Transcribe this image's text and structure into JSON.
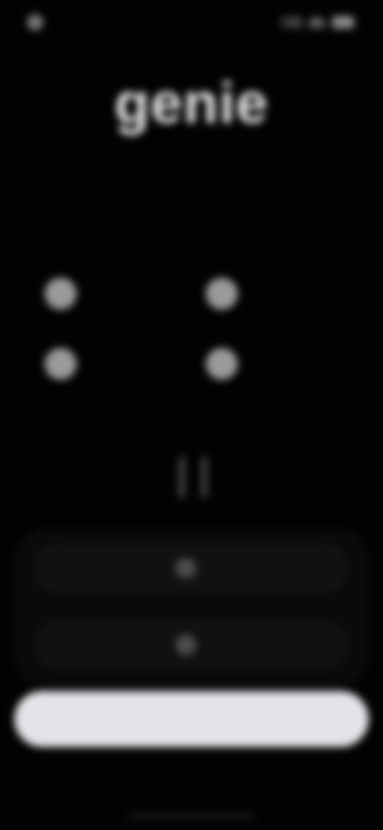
{
  "status_bar": {
    "time": "",
    "icons": [
      "cellular-signal-icon",
      "wifi-icon",
      "battery-icon"
    ]
  },
  "header": {
    "logo": "genie",
    "tagline": "",
    "section_label": ""
  },
  "features": [
    {
      "icon": "feature-icon",
      "label": ""
    },
    {
      "icon": "feature-icon",
      "label": ""
    },
    {
      "icon": "feature-icon",
      "label": ""
    },
    {
      "icon": "feature-icon",
      "label": ""
    }
  ],
  "award": {
    "title": "",
    "subtitle": ""
  },
  "plans": [
    {
      "label": ""
    },
    {
      "label": ""
    }
  ],
  "cta": {
    "continue_label": ""
  },
  "footer": {
    "links": [
      "",
      "",
      ""
    ]
  },
  "colors": {
    "background": "#020203",
    "button": "#e4e4e8",
    "award_accent": "#6b6656"
  }
}
